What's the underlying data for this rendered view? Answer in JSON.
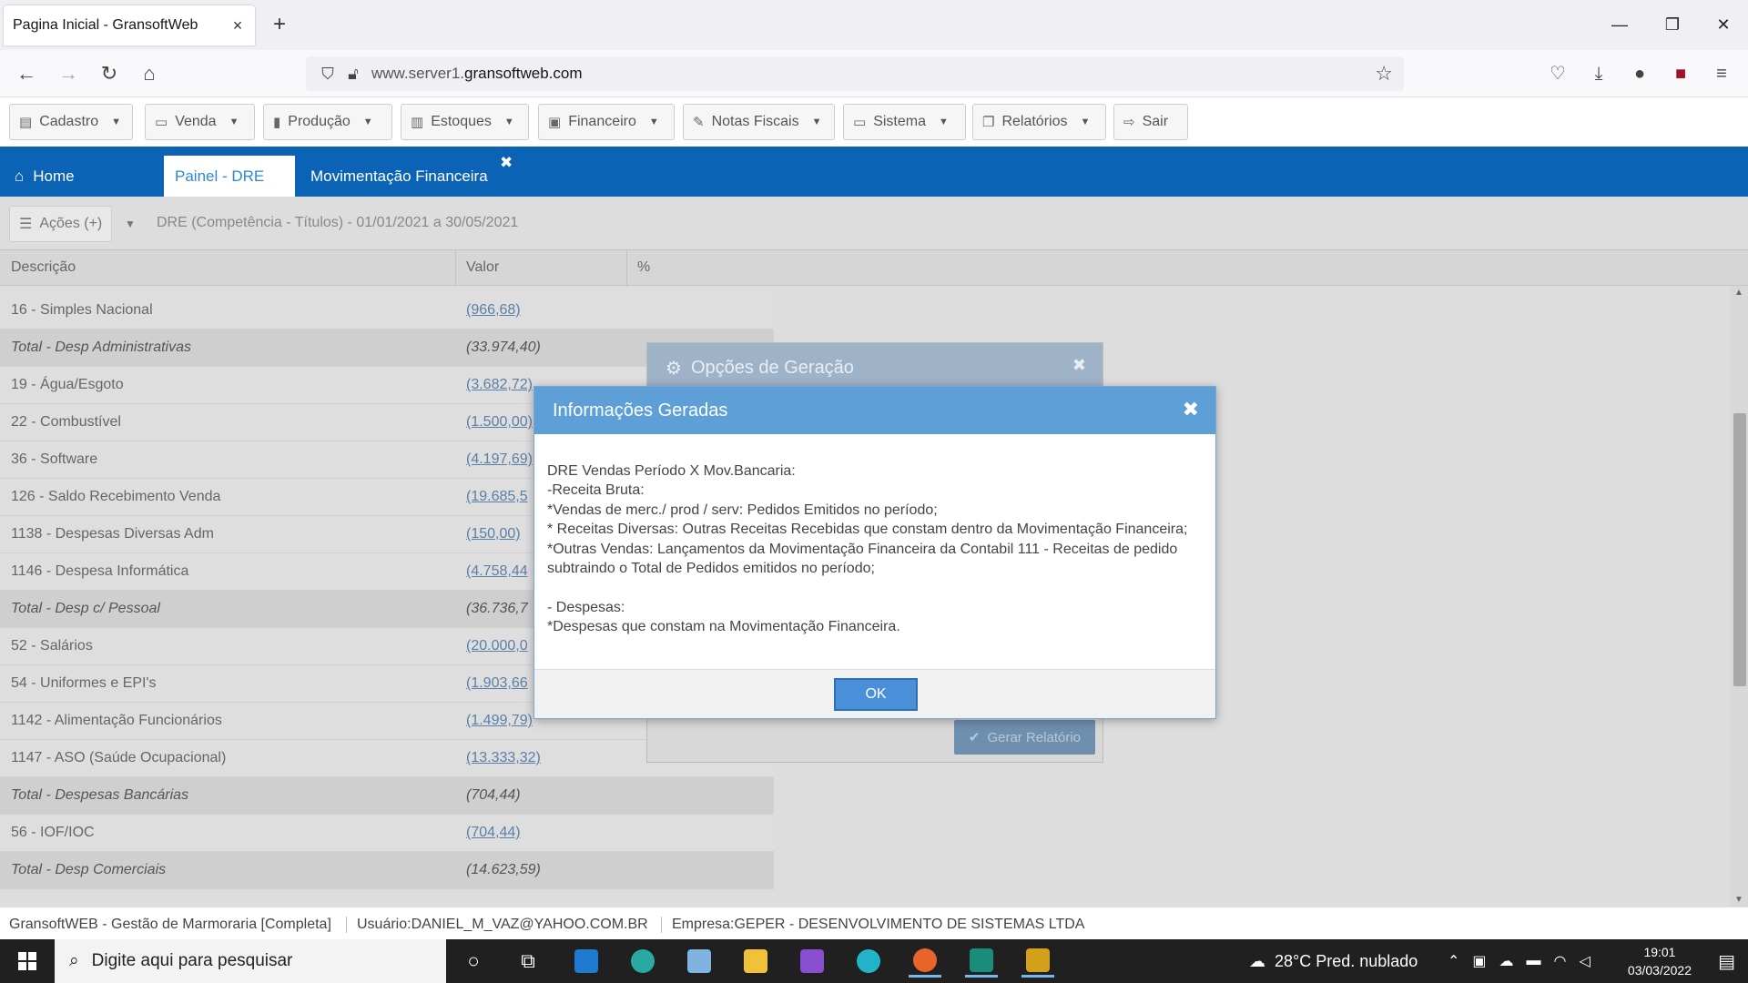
{
  "browser": {
    "tab_title": "Pagina Inicial - GransoftWeb",
    "url_prefix": "www.server1.",
    "url_domain": "gransoftweb.com"
  },
  "menu": [
    {
      "label": "Cadastro",
      "icon": "document-icon"
    },
    {
      "label": "Venda",
      "icon": "card-icon"
    },
    {
      "label": "Produção",
      "icon": "chart-icon"
    },
    {
      "label": "Estoques",
      "icon": "barcode-icon"
    },
    {
      "label": "Financeiro",
      "icon": "money-icon"
    },
    {
      "label": "Notas Fiscais",
      "icon": "edit-icon"
    },
    {
      "label": "Sistema",
      "icon": "laptop-icon"
    },
    {
      "label": "Relatórios",
      "icon": "copy-icon"
    },
    {
      "label": "Sair",
      "icon": "logout-icon"
    }
  ],
  "app_tabs": {
    "home": "Home",
    "active": "Painel - DRE",
    "second": "Movimentação Financeira"
  },
  "toolbar": {
    "acoes": "Ações (+)",
    "period": "DRE (Competência - Títulos) - 01/01/2021 a 30/05/2021"
  },
  "table": {
    "headers": [
      "Descrição",
      "Valor",
      "%"
    ],
    "rows": [
      {
        "desc": "16 - Simples Nacional",
        "val": "(966,68)",
        "total": false
      },
      {
        "desc": "Total - Desp Administrativas",
        "val": "(33.974,40)",
        "total": true
      },
      {
        "desc": "19 - Água/Esgoto",
        "val": "(3.682,72)",
        "total": false
      },
      {
        "desc": "22 - Combustível",
        "val": "(1.500,00)",
        "total": false
      },
      {
        "desc": "36 - Software",
        "val": "(4.197,69)",
        "total": false
      },
      {
        "desc": "126 - Saldo Recebimento Venda",
        "val": "(19.685,5",
        "total": false
      },
      {
        "desc": "1138 - Despesas Diversas Adm",
        "val": "(150,00)",
        "total": false
      },
      {
        "desc": "1146 - Despesa Informática",
        "val": "(4.758,44",
        "total": false
      },
      {
        "desc": "Total - Desp c/ Pessoal",
        "val": "(36.736,7",
        "total": true
      },
      {
        "desc": "52 - Salários",
        "val": "(20.000,0",
        "total": false
      },
      {
        "desc": "54 - Uniformes e EPI's",
        "val": "(1.903,66",
        "total": false
      },
      {
        "desc": "1142 - Alimentação Funcionários",
        "val": "(1.499,79)",
        "total": false
      },
      {
        "desc": "1147 - ASO (Saúde Ocupacional)",
        "val": "(13.333,32)",
        "total": false
      },
      {
        "desc": "Total - Despesas Bancárias",
        "val": "(704,44)",
        "total": true
      },
      {
        "desc": "56 - IOF/IOC",
        "val": "(704,44)",
        "total": false
      },
      {
        "desc": "Total - Desp Comerciais",
        "val": "(14.623,59)",
        "total": true
      }
    ]
  },
  "bg_dialog": {
    "title": "Opções de Geração",
    "button": "Gerar Relatório"
  },
  "modal": {
    "title": "Informações Geradas",
    "lines": [
      "DRE Vendas Período X Mov.Bancaria:",
      "-Receita Bruta:",
      "*Vendas de merc./ prod / serv: Pedidos Emitidos no período;",
      "* Receitas Diversas: Outras Receitas Recebidas que constam dentro da Movimentação Financeira;",
      "*Outras Vendas: Lançamentos da Movimentação Financeira da Contabil 111 - Receitas de pedido subtraindo o Total de Pedidos emitidos no período;",
      "",
      "- Despesas:",
      "*Despesas que constam na Movimentação Financeira."
    ],
    "ok": "OK"
  },
  "status": {
    "app": "GransoftWEB - Gestão de Marmoraria [Completa]",
    "user": "Usuário:DANIEL_M_VAZ@YAHOO.COM.BR",
    "company": "Empresa:GEPER - DESENVOLVIMENTO DE SISTEMAS LTDA"
  },
  "taskbar": {
    "search_placeholder": "Digite aqui para pesquisar",
    "weather": "28°C  Pred. nublado",
    "time": "19:01",
    "date": "03/03/2022"
  },
  "colors": {
    "app_blue": "#0b63b6",
    "modal_header": "#5d9fd6",
    "ok_button": "#4a90d9"
  }
}
